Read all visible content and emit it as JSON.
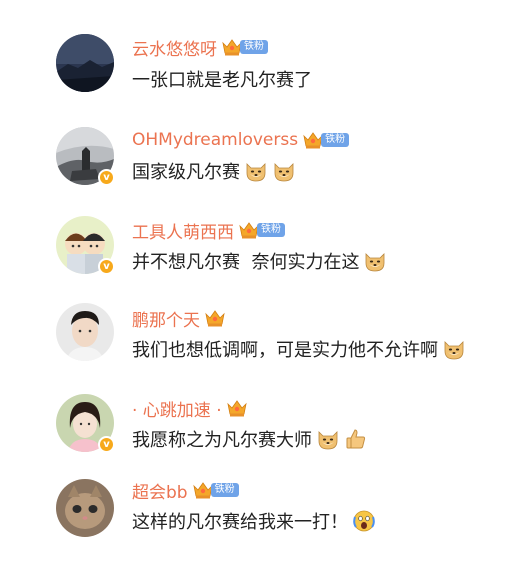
{
  "comments": [
    {
      "username": "云水悠悠呀",
      "fan_badge": "铁粉",
      "text": "一张口就是老凡尔赛了",
      "emojis": []
    },
    {
      "username": "OHMydreamloverss",
      "fan_badge": "铁粉",
      "text": "国家级凡尔赛",
      "emojis": [
        "doge-emoji",
        "doge-emoji"
      ]
    },
    {
      "username": "工具人萌西西",
      "fan_badge": "铁粉",
      "text": "并不想凡尔赛  奈何实力在这",
      "emojis": [
        "doge-emoji"
      ]
    },
    {
      "username": "鹏那个天",
      "fan_badge": "",
      "text": "我们也想低调啊，可是实力他不允许啊",
      "emojis": [
        "doge-emoji"
      ]
    },
    {
      "username": "· 心跳加速 ·",
      "fan_badge": "",
      "text": "我愿称之为凡尔赛大师",
      "emojis": [
        "doge-emoji",
        "thumbs-up-emoji"
      ]
    },
    {
      "username": "超会bb",
      "fan_badge": "铁粉",
      "text": "这样的凡尔赛给我来一打！",
      "emojis": [
        "screaming-face-emoji"
      ]
    }
  ],
  "colors": {
    "username": "#eb7350",
    "fan_badge": "#6fa3e8",
    "crown": "#f4a72a",
    "verified": "#f7a91b"
  },
  "icons": [
    "crown-icon",
    "verified-badge-icon"
  ]
}
